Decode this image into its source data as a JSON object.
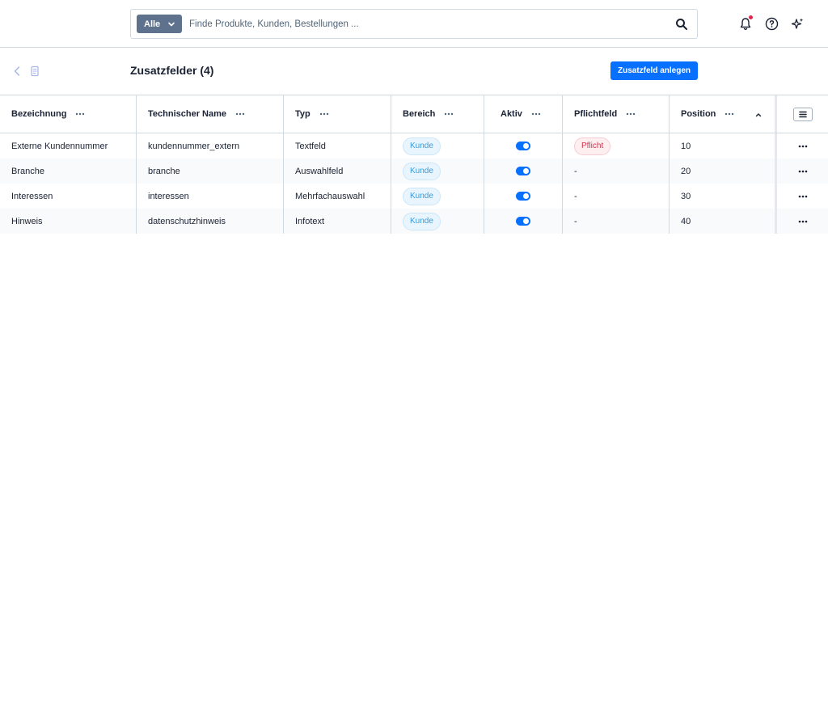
{
  "search": {
    "type_label": "Alle",
    "placeholder": "Finde Produkte, Kunden, Bestellungen ..."
  },
  "page": {
    "title": "Zusatzfelder (4)",
    "create_button": "Zusatzfeld anlegen"
  },
  "table": {
    "columns": [
      "Bezeichnung",
      "Technischer Name",
      "Typ",
      "Bereich",
      "Aktiv",
      "Pflichtfeld",
      "Position"
    ],
    "rows": [
      {
        "bezeichnung": "Externe Kundennummer",
        "technisch": "kundennummer_extern",
        "typ": "Textfeld",
        "bereich": "Kunde",
        "aktiv": true,
        "pflicht": "Pflicht",
        "position": "10"
      },
      {
        "bezeichnung": "Branche",
        "technisch": "branche",
        "typ": "Auswahlfeld",
        "bereich": "Kunde",
        "aktiv": true,
        "pflicht": "-",
        "position": "20"
      },
      {
        "bezeichnung": "Interessen",
        "technisch": "interessen",
        "typ": "Mehrfachauswahl",
        "bereich": "Kunde",
        "aktiv": true,
        "pflicht": "-",
        "position": "30"
      },
      {
        "bezeichnung": "Hinweis",
        "technisch": "datenschutzhinweis",
        "typ": "Infotext",
        "bereich": "Kunde",
        "aktiv": true,
        "pflicht": "-",
        "position": "40"
      }
    ]
  },
  "colors": {
    "primary": "#0870ff",
    "notification": "#de294c",
    "badge_blue": "#3b9ad9",
    "badge_red": "#c9374f"
  },
  "icons": [
    "chevron-down-icon",
    "search-icon",
    "bell-icon",
    "help-icon",
    "sparkle-icon",
    "back-icon",
    "document-icon",
    "more-icon",
    "sort-up-icon",
    "list-settings-icon"
  ]
}
